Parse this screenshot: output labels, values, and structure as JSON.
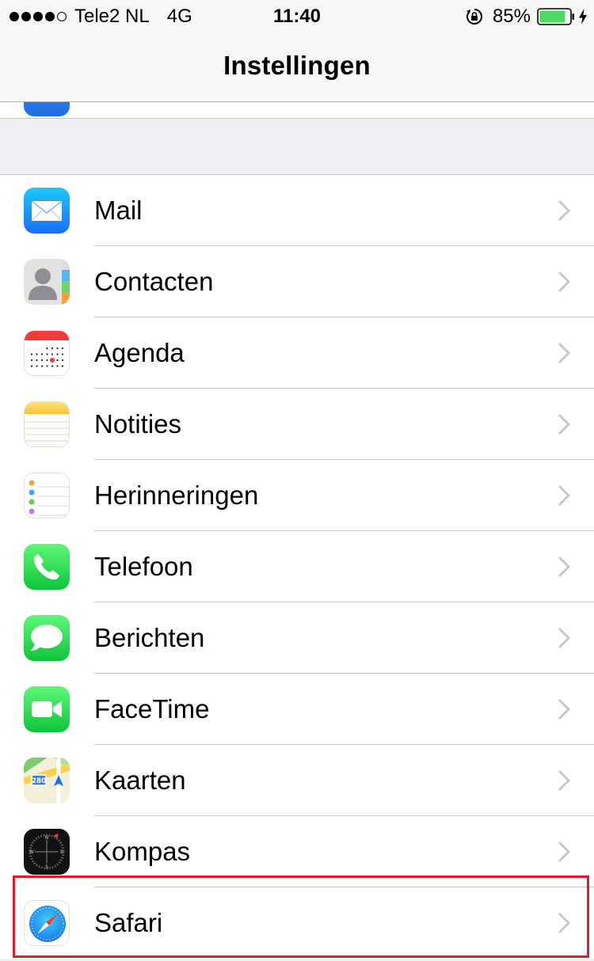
{
  "status_bar": {
    "carrier": "Tele2 NL",
    "network": "4G",
    "time": "11:40",
    "battery_percent": "85%",
    "battery_level": 0.85,
    "signal_bars_filled": 4,
    "signal_bars_total": 5,
    "icons": [
      "signal-dots",
      "orientation-lock-icon",
      "battery-icon",
      "charging-bolt-icon"
    ]
  },
  "nav": {
    "title": "Instellingen"
  },
  "settings_list": [
    {
      "label": "Mail",
      "icon": "mail-icon"
    },
    {
      "label": "Contacten",
      "icon": "contacts-icon"
    },
    {
      "label": "Agenda",
      "icon": "calendar-icon"
    },
    {
      "label": "Notities",
      "icon": "notes-icon"
    },
    {
      "label": "Herinneringen",
      "icon": "reminders-icon"
    },
    {
      "label": "Telefoon",
      "icon": "phone-icon"
    },
    {
      "label": "Berichten",
      "icon": "messages-icon"
    },
    {
      "label": "FaceTime",
      "icon": "facetime-icon"
    },
    {
      "label": "Kaarten",
      "icon": "maps-icon",
      "badge": "280"
    },
    {
      "label": "Kompas",
      "icon": "compass-icon",
      "letters": [
        "N",
        "W",
        "E",
        "S"
      ]
    },
    {
      "label": "Safari",
      "icon": "safari-icon",
      "highlighted": true
    }
  ],
  "colors": {
    "highlight_border": "#d9202d",
    "background": "#efeff4",
    "separator": "#c8c7cc",
    "chevron": "#c7c7cc",
    "battery_fill": "#4cd964"
  }
}
